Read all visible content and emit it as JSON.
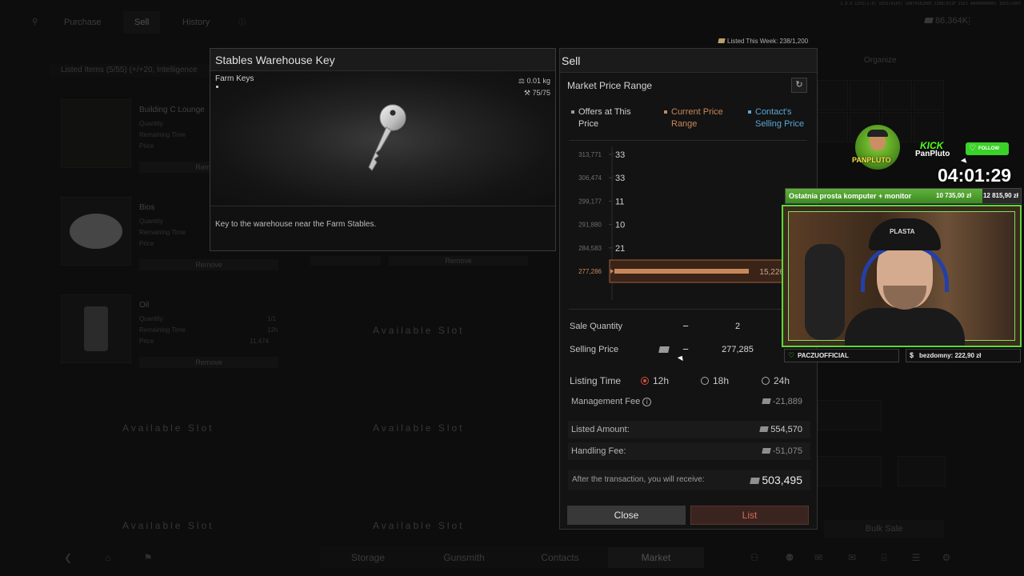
{
  "background": {
    "topnav": {
      "tabs": [
        "Purchase",
        "Sell",
        "History"
      ],
      "active_tab": "Sell",
      "balance": "86,364K"
    },
    "coords_text": "1.0.0.1252(1.0) 1652(9203) 14874162003 2398(011F 2321 4040000000) 1023(1007",
    "listed_items": "Listed Items (5/55) (+/+20, Intelligence",
    "organize": "Organize",
    "cards": [
      {
        "name": "Building C Lounge",
        "lines": [
          "Quantity",
          "Remaining Time",
          "Price"
        ],
        "remove": "Remove"
      },
      {
        "name": "Bios",
        "lines": [
          "Quantity",
          "Remaining Time",
          "Price"
        ],
        "remove": "Remove"
      },
      {
        "name": "Oil",
        "lines": [
          "Quantity",
          "Remaining Time",
          "Price"
        ],
        "remove": "Remove",
        "values": [
          "1/1",
          "12h",
          "11,474"
        ]
      }
    ],
    "second_column_remove": [
      "Remove",
      "Remove"
    ],
    "available_slot": "Available Slot",
    "bulk_sale": "Bulk Sale",
    "bottomnav": {
      "tabs": [
        "Storage",
        "Gunsmith",
        "Contacts",
        "Market"
      ],
      "active_tab": "Market"
    }
  },
  "item": {
    "title": "Stables Warehouse Key",
    "category": "Farm Keys",
    "weight": "0.01 kg",
    "durability": "75/75",
    "description": "Key to the warehouse near the Farm Stables."
  },
  "listed_this_week": "Listed This Week: 238/1,200",
  "sell": {
    "title": "Sell",
    "market_price_range": "Market Price Range",
    "legend": [
      {
        "label": "Offers at This Price",
        "color": "#9a9a9a"
      },
      {
        "label": "Current Price Range",
        "color": "#c8875a"
      },
      {
        "label": "Contact's Selling Price",
        "color": "#5aa7d6"
      }
    ],
    "sale_quantity_label": "Sale Quantity",
    "sale_quantity": "2",
    "selling_price_label": "Selling Price",
    "selling_price": "277,285",
    "listing_time_label": "Listing Time",
    "listing_options": [
      "12h",
      "18h",
      "24h"
    ],
    "listing_selected": "12h",
    "management_fee_label": "Management Fee",
    "management_fee": "-21,889",
    "listed_amount_label": "Listed Amount:",
    "listed_amount": "554,570",
    "handling_fee_label": "Handling Fee:",
    "handling_fee": "-51,075",
    "receive_label": "After the transaction, you will receive:",
    "receive_amount": "503,495",
    "close_label": "Close",
    "list_label": "List",
    "accent_color": "#d14e3a"
  },
  "chart_data": {
    "type": "bar",
    "orientation": "horizontal",
    "categories": [
      "313,771",
      "306,474",
      "299,177",
      "291,880",
      "284,583",
      "277,286"
    ],
    "values": [
      33,
      33,
      11,
      10,
      21,
      15226
    ],
    "value_labels": [
      "33",
      "33",
      "11",
      "10",
      "21",
      "15,226"
    ],
    "highlighted_category": "277,286",
    "highlight_color": "#c8875a"
  },
  "overlay": {
    "kick_label": "KICK",
    "channel": "PanPluto",
    "avatar_tag": "PANPLUTO",
    "follow": "FOLLOW",
    "timer": "04:01:29",
    "goal_title": "Ostatnia prosta komputer + monitor",
    "goal_progress": "10 735,00 zł",
    "goal_target": "12 815,90 zł",
    "goal_fraction": 0.8376,
    "cap_text": "PLASTA",
    "donor_left": "PACZUOFFICIAL",
    "donor_right": "bezdomny: 222,90 zł"
  }
}
